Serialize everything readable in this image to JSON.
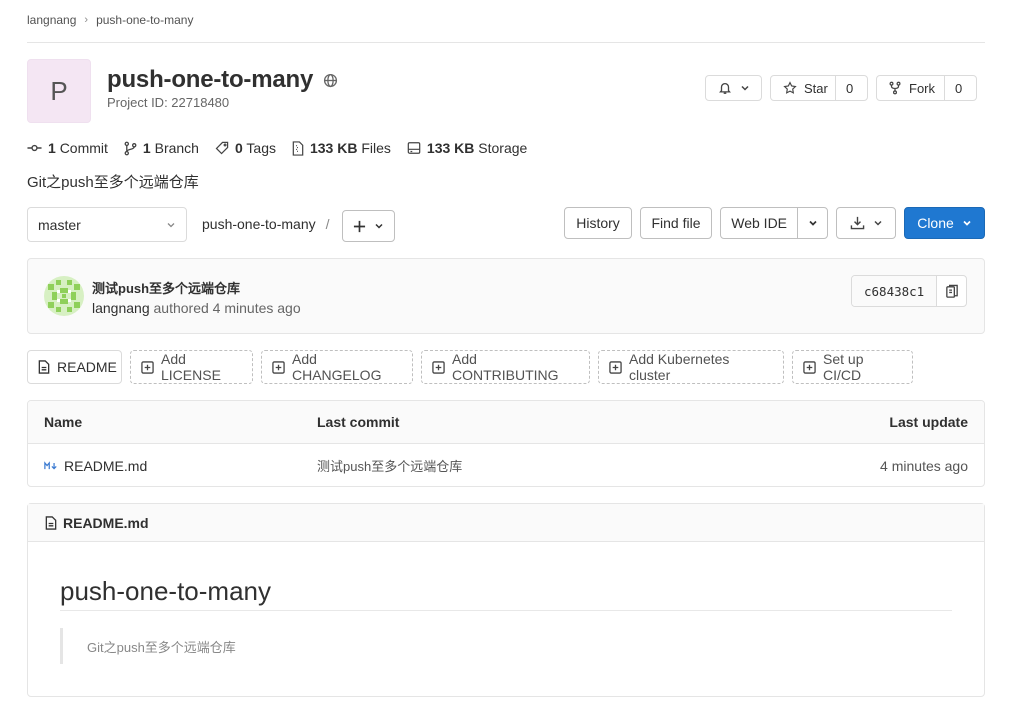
{
  "breadcrumb": {
    "owner": "langnang",
    "project": "push-one-to-many"
  },
  "project": {
    "avatar_letter": "P",
    "name": "push-one-to-many",
    "id_label": "Project ID: 22718480",
    "description": "Git之push至多个远端仓库"
  },
  "actions": {
    "star_label": "Star",
    "star_count": "0",
    "fork_label": "Fork",
    "fork_count": "0"
  },
  "stats": {
    "commits_count": "1",
    "commits_label": "Commit",
    "branches_count": "1",
    "branches_label": "Branch",
    "tags_count": "0",
    "tags_label": "Tags",
    "files_size": "133 KB",
    "files_label": "Files",
    "storage_size": "133 KB",
    "storage_label": "Storage"
  },
  "toolbar": {
    "branch": "master",
    "path": "push-one-to-many",
    "path_sep": "/",
    "history": "History",
    "find_file": "Find file",
    "web_ide": "Web IDE",
    "clone": "Clone"
  },
  "last_commit": {
    "title": "测试push至多个远端仓库",
    "author": "langnang",
    "authored_text": "authored 4 minutes ago",
    "sha": "c68438c1"
  },
  "quick_actions": [
    "README",
    "Add LICENSE",
    "Add CHANGELOG",
    "Add CONTRIBUTING",
    "Add Kubernetes cluster",
    "Set up CI/CD"
  ],
  "file_table": {
    "headers": {
      "name": "Name",
      "last_commit": "Last commit",
      "last_update": "Last update"
    },
    "rows": [
      {
        "name": "README.md",
        "commit": "测试push至多个远端仓库",
        "updated": "4 minutes ago"
      }
    ]
  },
  "readme": {
    "filename": "README.md",
    "heading": "push-one-to-many",
    "quote": "Git之push至多个远端仓库"
  },
  "colors": {
    "primary": "#1f78d1",
    "avatar_bg": "#f4e6f3",
    "border": "#e5e5e5"
  }
}
